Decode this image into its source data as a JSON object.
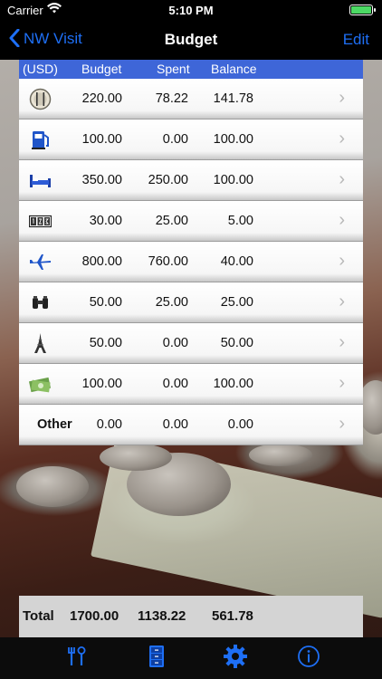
{
  "status_bar": {
    "carrier": "Carrier",
    "time": "5:10 PM"
  },
  "nav": {
    "back_label": "NW Visit",
    "title": "Budget",
    "edit_label": "Edit"
  },
  "table": {
    "headers": {
      "currency": "(USD)",
      "budget": "Budget",
      "spent": "Spent",
      "balance": "Balance"
    },
    "rows": [
      {
        "icon": "dining-icon",
        "budget": "220.00",
        "spent": "78.22",
        "balance": "141.78"
      },
      {
        "icon": "fuel-pump-icon",
        "budget": "100.00",
        "spent": "0.00",
        "balance": "100.00"
      },
      {
        "icon": "bed-icon",
        "budget": "350.00",
        "spent": "250.00",
        "balance": "100.00"
      },
      {
        "icon": "ticket-icon",
        "budget": "30.00",
        "spent": "25.00",
        "balance": "5.00"
      },
      {
        "icon": "airplane-icon",
        "budget": "800.00",
        "spent": "760.00",
        "balance": "40.00"
      },
      {
        "icon": "binoculars-icon",
        "budget": "50.00",
        "spent": "25.00",
        "balance": "25.00"
      },
      {
        "icon": "eiffel-tower-icon",
        "budget": "50.00",
        "spent": "0.00",
        "balance": "50.00"
      },
      {
        "icon": "money-icon",
        "budget": "100.00",
        "spent": "0.00",
        "balance": "100.00"
      },
      {
        "label": "Other",
        "budget": "0.00",
        "spent": "0.00",
        "balance": "0.00"
      }
    ]
  },
  "totals": {
    "label": "Total",
    "budget": "1700.00",
    "spent": "1138.22",
    "balance": "561.78"
  },
  "tab_bar": {
    "items": [
      {
        "icon": "tools-icon"
      },
      {
        "icon": "file-cabinet-icon"
      },
      {
        "icon": "gear-icon"
      },
      {
        "icon": "info-icon"
      }
    ]
  },
  "colors": {
    "accent": "#1e6ff5",
    "header_blue": "#3e66d8"
  }
}
